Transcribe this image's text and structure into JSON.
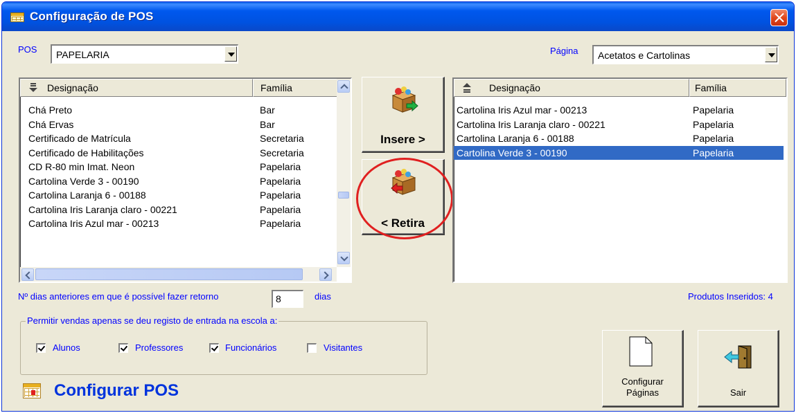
{
  "window": {
    "title": "Configuração de POS"
  },
  "pos": {
    "label": "POS",
    "selected": "PAPELARIA"
  },
  "pagina": {
    "label": "Página",
    "selected": "Acetatos e Cartolinas"
  },
  "left_list": {
    "headers": [
      "Designação",
      "Família"
    ],
    "rows": [
      [
        "Chá Preto",
        "Bar"
      ],
      [
        "Chá Ervas",
        "Bar"
      ],
      [
        "Certificado de Matrícula",
        "Secretaria"
      ],
      [
        "Certificado de Habilitações",
        "Secretaria"
      ],
      [
        "CD R-80 min Imat. Neon",
        "Papelaria"
      ],
      [
        "Cartolina Verde 3 - 00190",
        "Papelaria"
      ],
      [
        "Cartolina Laranja 6 - 00188",
        "Papelaria"
      ],
      [
        "Cartolina Iris Laranja claro - 00221",
        "Papelaria"
      ],
      [
        "Cartolina Iris Azul mar - 00213",
        "Papelaria"
      ]
    ]
  },
  "right_list": {
    "headers": [
      "Designação",
      "Família"
    ],
    "rows": [
      [
        "Cartolina Iris Azul mar - 00213",
        "Papelaria"
      ],
      [
        "Cartolina Iris Laranja claro - 00221",
        "Papelaria"
      ],
      [
        "Cartolina Laranja 6 - 00188",
        "Papelaria"
      ],
      [
        "Cartolina Verde 3 - 00190",
        "Papelaria"
      ]
    ],
    "selected_index": 3
  },
  "buttons": {
    "insere": "Insere >",
    "retira": "< Retira",
    "configurar": "Configurar",
    "paginas": "Páginas",
    "sair": "Sair"
  },
  "retorno": {
    "label": "Nº dias anteriores em que é possível fazer retorno",
    "value": "8",
    "unit": "dias"
  },
  "produtos_inseridos": "Produtos Inseridos: 4",
  "permitir": {
    "title": "Permitir vendas apenas se deu registo de entrada na escola a:",
    "options": [
      {
        "label": "Alunos",
        "checked": true
      },
      {
        "label": "Professores",
        "checked": true
      },
      {
        "label": "Funcionários",
        "checked": true
      },
      {
        "label": "Visitantes",
        "checked": false
      }
    ]
  },
  "footer_title": "Configurar POS",
  "colors": {
    "title_bar": "#0058ee",
    "selection": "#316ac5",
    "label_blue": "#0000ff",
    "highlight_circle": "#e02020"
  },
  "icons": [
    "window-grid-icon",
    "close-icon",
    "sort-down-icon",
    "sort-up-icon",
    "insert-box-icon",
    "remove-box-icon",
    "page-icon",
    "exit-door-icon"
  ]
}
